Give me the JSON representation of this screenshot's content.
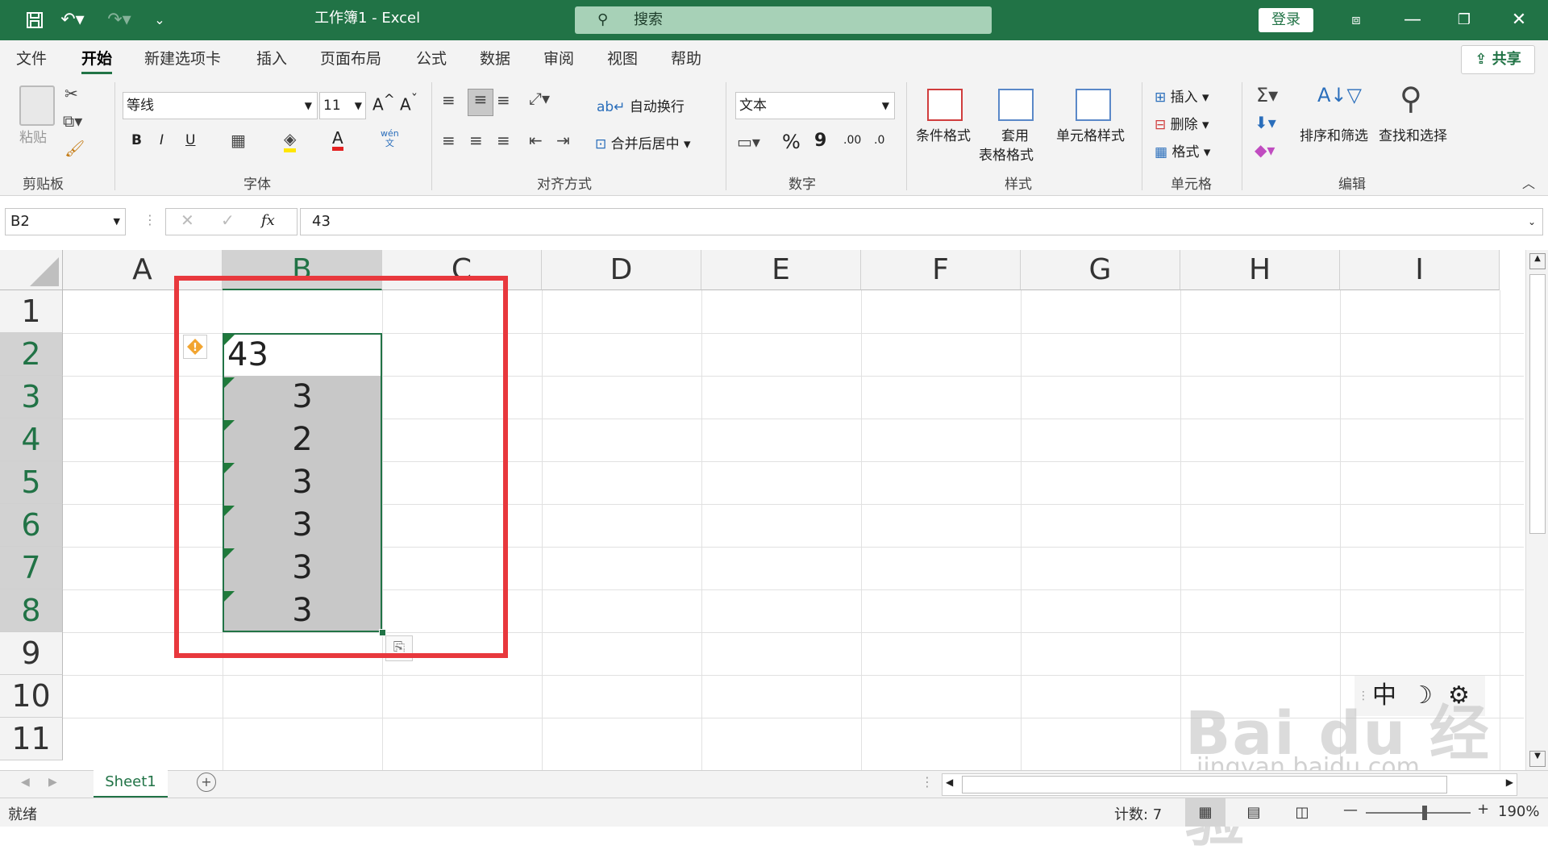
{
  "app": {
    "doc_title": "工作簿1  -  Excel",
    "search_placeholder": "搜索",
    "signin": "登录"
  },
  "tabs": [
    "文件",
    "开始",
    "新建选项卡",
    "插入",
    "页面布局",
    "公式",
    "数据",
    "审阅",
    "视图",
    "帮助"
  ],
  "share": "共享",
  "ribbon": {
    "clipboard": {
      "paste": "粘贴",
      "label": "剪贴板"
    },
    "font": {
      "name": "等线",
      "size": "11",
      "bold": "B",
      "italic": "I",
      "underline": "U",
      "grow": "A",
      "shrink": "A",
      "color_a": "A",
      "wen": "wén",
      "wen2": "文",
      "label": "字体"
    },
    "align": {
      "wrap": "自动换行",
      "merge": "合并后居中",
      "label": "对齐方式"
    },
    "number": {
      "format": "文本",
      "percent": "%",
      "comma": "9",
      "inc": ".00",
      "dec": ".0",
      "label": "数字"
    },
    "styles": {
      "cond": "条件格式",
      "table1": "套用",
      "table2": "表格格式",
      "cell": "单元格样式",
      "label": "样式"
    },
    "cells": {
      "insert": "插入",
      "delete": "删除",
      "format": "格式",
      "label": "单元格"
    },
    "edit": {
      "sort": "排序和筛选",
      "find": "查找和选择",
      "label": "编辑"
    }
  },
  "formula_bar": {
    "name_box": "B2",
    "fx": "fx",
    "value": "43"
  },
  "columns": [
    "A",
    "B",
    "C",
    "D",
    "E",
    "F",
    "G",
    "H",
    "I"
  ],
  "rows": [
    "1",
    "2",
    "3",
    "4",
    "5",
    "6",
    "7",
    "8",
    "9",
    "10",
    "11"
  ],
  "cells_b": [
    "43",
    "3",
    "2",
    "3",
    "3",
    "3",
    "3"
  ],
  "sheet_tab": "Sheet1",
  "status": {
    "ready": "就绪",
    "count": "计数: 7",
    "zoom": "190%"
  },
  "ime": {
    "lang": "中"
  },
  "watermark": {
    "logo": "Bai du 经验",
    "url": "jingyan.baidu.com"
  },
  "colors": {
    "excel_green": "#217346",
    "highlight_red": "#e8383d",
    "selection_gray": "#c8c8c8"
  }
}
